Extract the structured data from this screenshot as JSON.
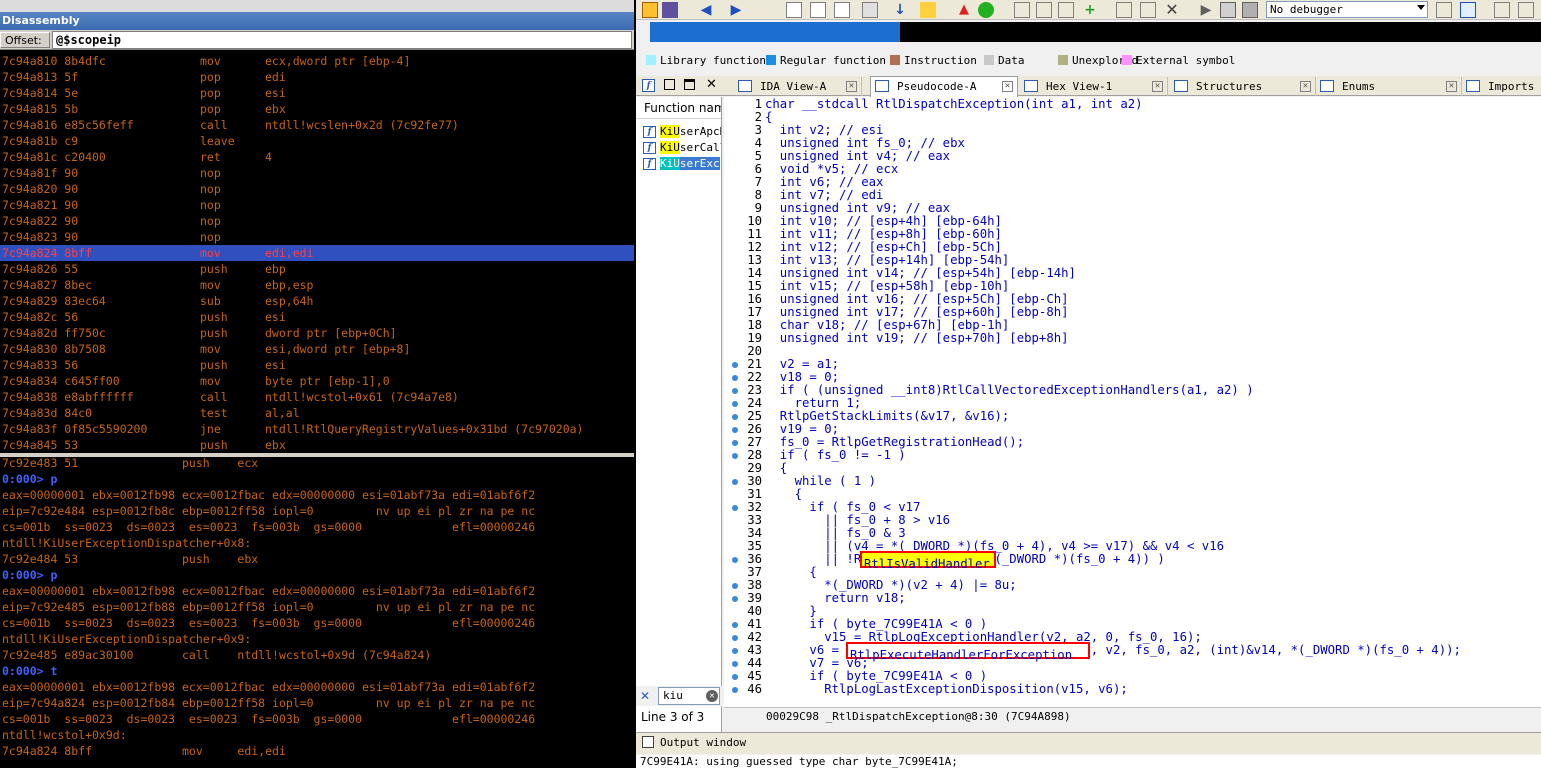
{
  "disassembly": {
    "title": "Disassembly",
    "offset_label": "Offset:",
    "offset_value": "@$scopeip",
    "rows": [
      {
        "addr": "7c94a810 8b4dfc",
        "mnem": "mov",
        "ops": "ecx,dword ptr [ebp-4]"
      },
      {
        "addr": "7c94a813 5f",
        "mnem": "pop",
        "ops": "edi"
      },
      {
        "addr": "7c94a814 5e",
        "mnem": "pop",
        "ops": "esi"
      },
      {
        "addr": "7c94a815 5b",
        "mnem": "pop",
        "ops": "ebx"
      },
      {
        "addr": "7c94a816 e85c56feff",
        "mnem": "call",
        "ops": "ntdll!wcslen+0x2d (7c92fe77)"
      },
      {
        "addr": "7c94a81b c9",
        "mnem": "leave",
        "ops": ""
      },
      {
        "addr": "7c94a81c c20400",
        "mnem": "ret",
        "ops": "4"
      },
      {
        "addr": "7c94a81f 90",
        "mnem": "nop",
        "ops": ""
      },
      {
        "addr": "7c94a820 90",
        "mnem": "nop",
        "ops": ""
      },
      {
        "addr": "7c94a821 90",
        "mnem": "nop",
        "ops": ""
      },
      {
        "addr": "7c94a822 90",
        "mnem": "nop",
        "ops": ""
      },
      {
        "addr": "7c94a823 90",
        "mnem": "nop",
        "ops": ""
      },
      {
        "addr": "7c94a824 8bff",
        "mnem": "mov",
        "ops": "edi,edi"
      },
      {
        "addr": "7c94a826 55",
        "mnem": "push",
        "ops": "ebp"
      },
      {
        "addr": "7c94a827 8bec",
        "mnem": "mov",
        "ops": "ebp,esp"
      },
      {
        "addr": "7c94a829 83ec64",
        "mnem": "sub",
        "ops": "esp,64h"
      },
      {
        "addr": "7c94a82c 56",
        "mnem": "push",
        "ops": "esi"
      },
      {
        "addr": "7c94a82d ff750c",
        "mnem": "push",
        "ops": "dword ptr [ebp+0Ch]"
      },
      {
        "addr": "7c94a830 8b7508",
        "mnem": "mov",
        "ops": "esi,dword ptr [ebp+8]"
      },
      {
        "addr": "7c94a833 56",
        "mnem": "push",
        "ops": "esi"
      },
      {
        "addr": "7c94a834 c645ff00",
        "mnem": "mov",
        "ops": "byte ptr [ebp-1],0"
      },
      {
        "addr": "7c94a838 e8abffffff",
        "mnem": "call",
        "ops": "ntdll!wcstol+0x61 (7c94a7e8)"
      },
      {
        "addr": "7c94a83d 84c0",
        "mnem": "test",
        "ops": "al,al"
      },
      {
        "addr": "7c94a83f 0f85c5590200",
        "mnem": "jne",
        "ops": "ntdll!RtlQueryRegistryValues+0x31bd (7c97020a)"
      },
      {
        "addr": "7c94a845 53",
        "mnem": "push",
        "ops": "ebx"
      }
    ]
  },
  "command": {
    "lines": [
      {
        "t": "7c92e483 51               push    ecx",
        "p": false
      },
      {
        "t": "0:000> p",
        "p": true
      },
      {
        "t": "eax=00000001 ebx=0012fb98 ecx=0012fbac edx=00000000 esi=01abf73a edi=01abf6f2",
        "p": false
      },
      {
        "t": "eip=7c92e484 esp=0012fb8c ebp=0012ff58 iopl=0         nv up ei pl zr na pe nc",
        "p": false
      },
      {
        "t": "cs=001b  ss=0023  ds=0023  es=0023  fs=003b  gs=0000             efl=00000246",
        "p": false
      },
      {
        "t": "ntdll!KiUserExceptionDispatcher+0x8:",
        "p": false
      },
      {
        "t": "7c92e484 53               push    ebx",
        "p": false
      },
      {
        "t": "0:000> p",
        "p": true
      },
      {
        "t": "eax=00000001 ebx=0012fb98 ecx=0012fbac edx=00000000 esi=01abf73a edi=01abf6f2",
        "p": false
      },
      {
        "t": "eip=7c92e485 esp=0012fb88 ebp=0012ff58 iopl=0         nv up ei pl zr na pe nc",
        "p": false
      },
      {
        "t": "cs=001b  ss=0023  ds=0023  es=0023  fs=003b  gs=0000             efl=00000246",
        "p": false
      },
      {
        "t": "ntdll!KiUserExceptionDispatcher+0x9:",
        "p": false
      },
      {
        "t": "7c92e485 e89ac30100       call    ntdll!wcstol+0x9d (7c94a824)",
        "p": false
      },
      {
        "t": "0:000> t",
        "p": true
      },
      {
        "t": "eax=00000001 ebx=0012fb98 ecx=0012fbac edx=00000000 esi=01abf73a edi=01abf6f2",
        "p": false
      },
      {
        "t": "eip=7c94a824 esp=0012fb84 ebp=0012ff58 iopl=0         nv up ei pl zr na pe nc",
        "p": false
      },
      {
        "t": "cs=001b  ss=0023  ds=0023  es=0023  fs=003b  gs=0000             efl=00000246",
        "p": false
      },
      {
        "t": "ntdll!wcstol+0x9d:",
        "p": false
      },
      {
        "t": "7c94a824 8bff             mov     edi,edi",
        "p": false
      }
    ]
  },
  "ida": {
    "debugger_select": "No debugger",
    "legend": [
      {
        "label": "Library function",
        "color": "#a0f0ff"
      },
      {
        "label": "Regular function",
        "color": "#1c8ee0"
      },
      {
        "label": "Instruction",
        "color": "#b07050"
      },
      {
        "label": "Data",
        "color": "#c8c8c8"
      },
      {
        "label": "Unexplored",
        "color": "#b0b080"
      },
      {
        "label": "External symbol",
        "color": "#ff90ff"
      }
    ],
    "tabs": [
      {
        "label": "IDA View-A"
      },
      {
        "label": "Pseudocode-A"
      },
      {
        "label": "Hex View-1"
      },
      {
        "label": "Structures"
      },
      {
        "label": "Enums"
      },
      {
        "label": "Imports"
      }
    ],
    "functions_header": "Function name",
    "functions": [
      {
        "hl": "KiU",
        "rest": "serApcD"
      },
      {
        "hl": "KiU",
        "rest": "serCall"
      },
      {
        "hl": "KiU",
        "rest": "serExc"
      }
    ],
    "search_value": "kiu",
    "line_status": "Line 3 of 3",
    "address_bar": "00029C98 _RtlDispatchException@8:30 (7C94A898)",
    "output_title": "Output window",
    "output_text": "7C99E41A: using guessed type char byte_7C99E41A;",
    "highlight_1": "RtlIsValidHandler",
    "highlight_2": "RtlpExecuteHandlerForException",
    "code": [
      "char __stdcall RtlDispatchException(int a1, int a2)",
      "{",
      "  int v2; // esi",
      "  unsigned int fs_0; // ebx",
      "  unsigned int v4; // eax",
      "  void *v5; // ecx",
      "  int v6; // eax",
      "  int v7; // edi",
      "  unsigned int v9; // eax",
      "  int v10; // [esp+4h] [ebp-64h]",
      "  int v11; // [esp+8h] [ebp-60h]",
      "  int v12; // [esp+Ch] [ebp-5Ch]",
      "  int v13; // [esp+14h] [ebp-54h]",
      "  unsigned int v14; // [esp+54h] [ebp-14h]",
      "  int v15; // [esp+58h] [ebp-10h]",
      "  unsigned int v16; // [esp+5Ch] [ebp-Ch]",
      "  unsigned int v17; // [esp+60h] [ebp-8h]",
      "  char v18; // [esp+67h] [ebp-1h]",
      "  unsigned int v19; // [esp+70h] [ebp+8h]",
      "",
      "  v2 = a1;",
      "  v18 = 0;",
      "  if ( (unsigned __int8)RtlCallVectoredExceptionHandlers(a1, a2) )",
      "    return 1;",
      "  RtlpGetStackLimits(&v17, &v16);",
      "  v19 = 0;",
      "  fs_0 = RtlpGetRegistrationHead();",
      "  if ( fs_0 != -1 )",
      "  {",
      "    while ( 1 )",
      "    {",
      "      if ( fs_0 < v17",
      "        || fs_0 + 8 > v16",
      "        || fs_0 & 3",
      "        || (v4 = *(_DWORD *)(fs_0 + 4), v4 >= v17) && v4 < v16",
      "        || !RtlIsValidHandler(*(_DWORD *)(fs_0 + 4)) )",
      "      {",
      "        *(_DWORD *)(v2 + 4) |= 8u;",
      "        return v18;",
      "      }",
      "      if ( byte_7C99E41A < 0 )",
      "        v15 = RtlpLogExceptionHandler(v2, a2, 0, fs_0, 16);",
      "      v6 = RtlpExecuteHandlerForException(v5, v2, fs_0, a2, (int)&v14, *(_DWORD *)(fs_0 + 4));",
      "      v7 = v6;",
      "      if ( byte_7C99E41A < 0 )",
      "        RtlpLogLastExceptionDisposition(v15, v6);"
    ],
    "line_numbers": [
      "1",
      "2",
      "3",
      "4",
      "5",
      "6",
      "7",
      "8",
      "9",
      "10",
      "11",
      "12",
      "13",
      "14",
      "15",
      "16",
      "17",
      "18",
      "19",
      "20",
      "21",
      "22",
      "23",
      "24",
      "25",
      "26",
      "27",
      "28",
      "29",
      "30",
      "31",
      "32",
      "33",
      "34",
      "35",
      "36",
      "37",
      "38",
      "39",
      "40",
      "41",
      "42",
      "43",
      "44",
      "45",
      "46"
    ]
  }
}
